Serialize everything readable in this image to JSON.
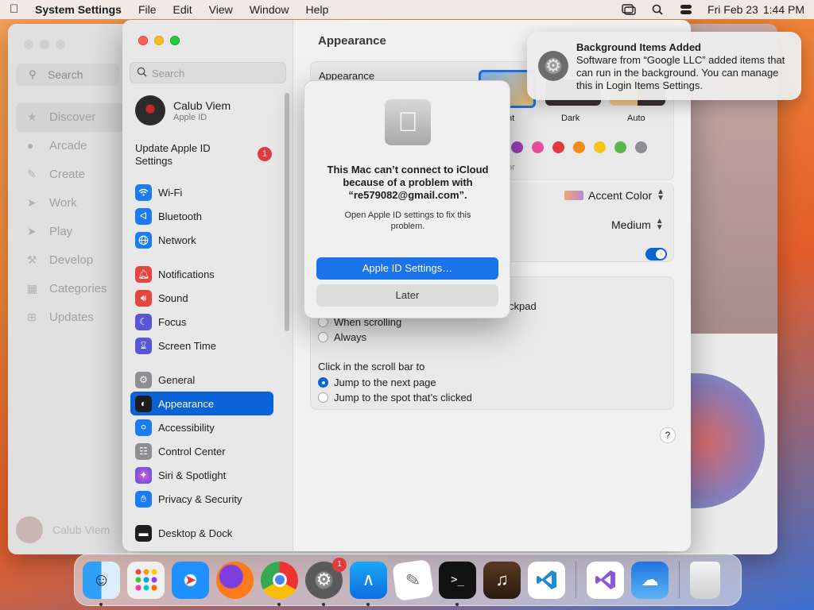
{
  "menubar": {
    "app_name": "System Settings",
    "menus": [
      "File",
      "Edit",
      "View",
      "Window",
      "Help"
    ],
    "date": "Fri Feb 23",
    "time": "1:44 PM"
  },
  "background_window": {
    "search_placeholder": "Search",
    "nav": [
      "Discover",
      "Arcade",
      "Create",
      "Work",
      "Play",
      "Develop",
      "Categories",
      "Updates"
    ],
    "user": "Calub Viem"
  },
  "settings": {
    "search_placeholder": "Search",
    "profile": {
      "name": "Calub Viem",
      "subtitle": "Apple ID"
    },
    "update": {
      "label": "Update Apple ID Settings",
      "badge": "1"
    },
    "nav_group_1": [
      {
        "label": "Wi-Fi",
        "icon": "wifi-icon",
        "color": "#1b7cf2"
      },
      {
        "label": "Bluetooth",
        "icon": "bluetooth-icon",
        "color": "#1b7cf2"
      },
      {
        "label": "Network",
        "icon": "globe-icon",
        "color": "#1b7cf2"
      }
    ],
    "nav_group_2": [
      {
        "label": "Notifications",
        "icon": "bell-icon",
        "color": "#e9453f"
      },
      {
        "label": "Sound",
        "icon": "speaker-icon",
        "color": "#e9453f"
      },
      {
        "label": "Focus",
        "icon": "moon-icon",
        "color": "#5856d6"
      },
      {
        "label": "Screen Time",
        "icon": "hourglass-icon",
        "color": "#5856d6"
      }
    ],
    "nav_group_3": [
      {
        "label": "General",
        "icon": "gear-icon",
        "color": "#8e8e93"
      },
      {
        "label": "Appearance",
        "icon": "appearance-icon",
        "color": "#1c1c1e",
        "selected": true
      },
      {
        "label": "Accessibility",
        "icon": "accessibility-icon",
        "color": "#1b7cf2"
      },
      {
        "label": "Control Center",
        "icon": "control-center-icon",
        "color": "#8e8e93"
      },
      {
        "label": "Siri & Spotlight",
        "icon": "siri-icon",
        "color": "#b14fd6"
      },
      {
        "label": "Privacy & Security",
        "icon": "hand-icon",
        "color": "#1b7cf2"
      }
    ],
    "nav_group_4": [
      {
        "label": "Desktop & Dock",
        "icon": "dock-icon",
        "color": "#1c1c1e"
      }
    ],
    "content": {
      "title": "Appearance",
      "appearance_label": "Appearance",
      "mode_labels": [
        "ht",
        "Dark",
        "Auto"
      ],
      "accent_partial": "or",
      "accent_color_label": "Accent Color",
      "size_value": "Medium",
      "trackpad_partial": "ckpad",
      "scroll_options": [
        "When scrolling",
        "Always"
      ],
      "click_label": "Click in the scroll bar to",
      "click_options": [
        "Jump to the next page",
        "Jump to the spot that’s clicked"
      ],
      "help": "?"
    }
  },
  "alert": {
    "title": "This Mac can’t connect to iCloud because of a problem with “re579082@gmail.com”.",
    "message": "Open Apple ID settings to fix this problem.",
    "primary_button": "Apple ID Settings…",
    "secondary_button": "Later"
  },
  "notification": {
    "title": "Background Items Added",
    "body": "Software from “Google LLC” added items that can run in the background. You can manage this in Login Items Settings."
  },
  "dock": {
    "badge": "1"
  }
}
